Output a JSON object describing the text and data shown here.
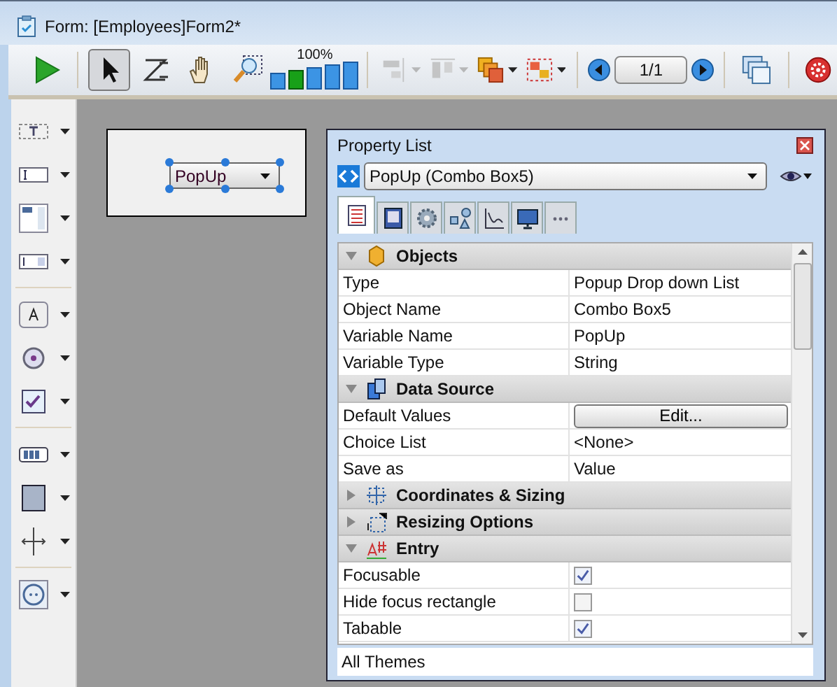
{
  "window": {
    "title": "Form: [Employees]Form2*"
  },
  "toolbar": {
    "tools": [
      {
        "kind": "run",
        "selected": false,
        "disabled": false
      },
      {
        "kind": "pointer",
        "selected": true,
        "disabled": false
      },
      {
        "kind": "zorder",
        "selected": false,
        "disabled": false
      },
      {
        "kind": "hand",
        "selected": false,
        "disabled": false
      },
      {
        "kind": "zoom",
        "selected": false,
        "disabled": false
      },
      {
        "kind": "align",
        "selected": false,
        "disabled": true
      },
      {
        "kind": "distribute",
        "selected": false,
        "disabled": true
      },
      {
        "kind": "level",
        "selected": false,
        "disabled": false
      },
      {
        "kind": "group",
        "selected": false,
        "disabled": false
      }
    ],
    "zoom_label": "100%",
    "zoom_bars": [
      {
        "selected": false
      },
      {
        "selected": true
      },
      {
        "selected": false
      },
      {
        "selected": false
      },
      {
        "selected": false
      }
    ],
    "page_indicator": "1/1"
  },
  "palette": [
    [
      {
        "kind": "static-text"
      },
      {
        "kind": "input"
      },
      {
        "kind": "list"
      },
      {
        "kind": "combo"
      }
    ],
    [
      {
        "kind": "button"
      },
      {
        "kind": "radio"
      },
      {
        "kind": "checkbox"
      }
    ],
    [
      {
        "kind": "progress"
      },
      {
        "kind": "rectangle"
      },
      {
        "kind": "splitter"
      }
    ],
    [
      {
        "kind": "plugin"
      }
    ]
  ],
  "form": {
    "popup_label": "PopUp"
  },
  "property_list": {
    "title": "Property List",
    "object_selector": "PopUp (Combo Box5)",
    "tabs": [
      {
        "kind": "list",
        "selected": true
      },
      {
        "kind": "book",
        "selected": false
      },
      {
        "kind": "gear",
        "selected": false
      },
      {
        "kind": "shapes",
        "selected": false
      },
      {
        "kind": "chart",
        "selected": false
      },
      {
        "kind": "monitor",
        "selected": false
      },
      {
        "kind": "more",
        "selected": false
      }
    ],
    "sections": [
      {
        "title": "Objects",
        "kind": "cube",
        "expanded": true,
        "rows": [
          {
            "label": "Type",
            "kind": "text",
            "value": "Popup Drop down List"
          },
          {
            "label": "Object Name",
            "kind": "text",
            "value": "Combo Box5"
          },
          {
            "label": "Variable Name",
            "kind": "text",
            "value": "PopUp"
          },
          {
            "label": "Variable Type",
            "kind": "text",
            "value": "String"
          }
        ]
      },
      {
        "title": "Data Source",
        "kind": "database",
        "expanded": true,
        "rows": [
          {
            "label": "Default Values",
            "kind": "button",
            "value": "Edit..."
          },
          {
            "label": "Choice List",
            "kind": "text",
            "value": "<None>"
          },
          {
            "label": "Save as",
            "kind": "text",
            "value": "Value"
          }
        ]
      },
      {
        "title": "Coordinates & Sizing",
        "kind": "coordinates",
        "expanded": false
      },
      {
        "title": "Resizing Options",
        "kind": "resizing",
        "expanded": false
      },
      {
        "title": "Entry",
        "kind": "entry",
        "expanded": true,
        "rows": [
          {
            "label": "Focusable",
            "kind": "checkbox",
            "checked": true
          },
          {
            "label": "Hide focus rectangle",
            "kind": "checkbox",
            "checked": false
          },
          {
            "label": "Tabable",
            "kind": "checkbox",
            "checked": true
          }
        ]
      }
    ],
    "footer": "All Themes"
  }
}
